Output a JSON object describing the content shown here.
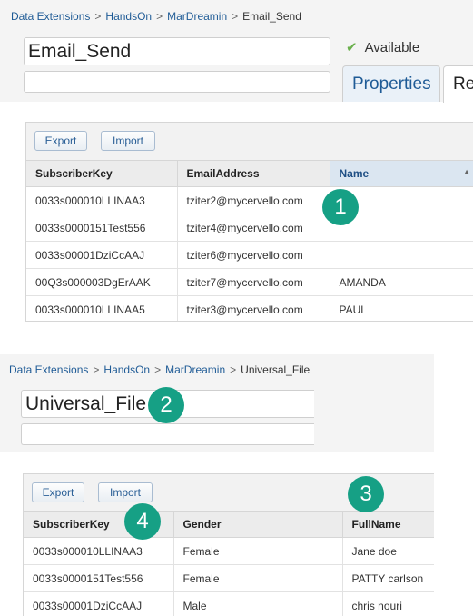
{
  "top": {
    "breadcrumb": {
      "item1": "Data Extensions",
      "item2": "HandsOn",
      "item3": "MarDreamin",
      "current": "Email_Send",
      "separator": ">"
    },
    "name_value": "Email_Send",
    "status_label": "Available",
    "tabs": {
      "properties": "Properties",
      "records_partial": "Re"
    },
    "toolbar": {
      "export": "Export",
      "import": "Import"
    },
    "columns": [
      "SubscriberKey",
      "EmailAddress",
      "Name"
    ],
    "rows": [
      [
        "0033s000010LLINAA3",
        "tziter2@mycervello.com",
        ""
      ],
      [
        "0033s0000151Test556",
        "tziter4@mycervello.com",
        ""
      ],
      [
        "0033s00001DziCcAAJ",
        "tziter6@mycervello.com",
        ""
      ],
      [
        "00Q3s000003DgErAAK",
        "tziter7@mycervello.com",
        "AMANDA"
      ],
      [
        "0033s000010LLINAA5",
        "tziter3@mycervello.com",
        "PAUL"
      ]
    ]
  },
  "bottom": {
    "breadcrumb": {
      "item1": "Data Extensions",
      "item2": "HandsOn",
      "item3": "MarDreamin",
      "current": "Universal_File",
      "separator": ">"
    },
    "name_value": "Universal_File",
    "toolbar": {
      "export": "Export",
      "import": "Import"
    },
    "columns": [
      "SubscriberKey",
      "Gender",
      "FullName"
    ],
    "rows": [
      [
        "0033s000010LLINAA3",
        "Female",
        "Jane doe"
      ],
      [
        "0033s0000151Test556",
        "Female",
        "PATTY carlson"
      ],
      [
        "0033s00001DziCcAAJ",
        "Male",
        "chris nouri"
      ]
    ]
  },
  "callouts": {
    "one": "1",
    "two": "2",
    "three": "3",
    "four": "4"
  },
  "colors": {
    "link": "#1f5b96",
    "check": "#6ab04c",
    "badge": "#16a085"
  }
}
